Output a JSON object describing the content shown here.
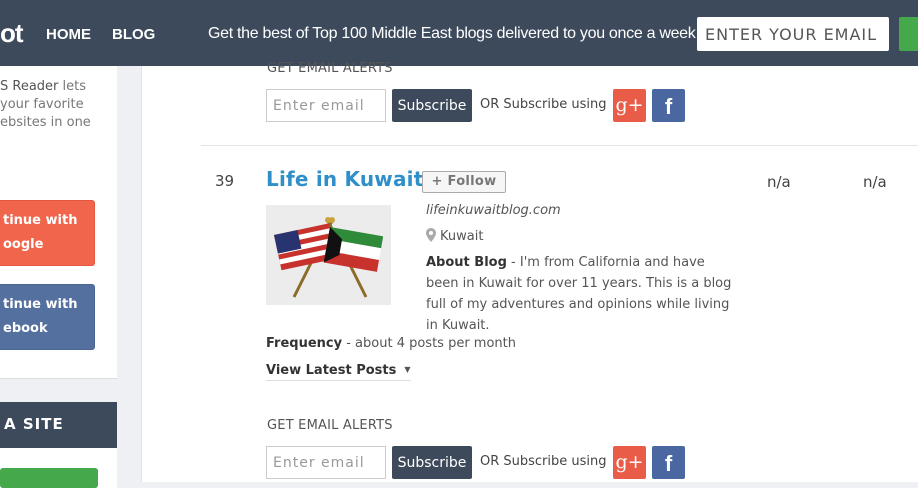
{
  "header": {
    "logo_text": "ot",
    "nav": [
      "HOME",
      "BLOG"
    ],
    "tagline": "Get the best of Top 100 Middle East blogs delivered to you once a week",
    "email_placeholder": "ENTER YOUR EMAIL ADDRESS",
    "colors": {
      "bar": "#3d4a5c",
      "go_button": "#45a84a"
    }
  },
  "sidebar": {
    "reader_brand": "S Reader",
    "reader_rest": " lets",
    "reader_line2": "your favorite",
    "reader_line3": "ebsites in one",
    "google_line1": "tinue with",
    "google_line2": "oogle",
    "facebook_line1": "tinue with",
    "facebook_line2": "ebook",
    "add_site": "A SITE"
  },
  "alerts_top": {
    "label": "GET EMAIL ALERTS",
    "email_placeholder": "Enter email",
    "subscribe": "Subscribe",
    "or_text": "OR  Subscribe using",
    "gplus_icon": "g+",
    "facebook_icon": "f"
  },
  "entry": {
    "rank": "39",
    "title": "Life in Kuwait",
    "follow": "+ Follow",
    "col1": "n/a",
    "col2": "n/a",
    "url": "lifeinkuwaitblog.com",
    "location": "Kuwait",
    "about_label": "About Blog",
    "about_text": " - I'm from California and have been in Kuwait for over 11 years. This is a blog full of my adventures and opinions while living in Kuwait.",
    "frequency_label": "Frequency",
    "frequency_text": " - about 4 posts per month",
    "latest_posts": "View Latest Posts"
  },
  "alerts_bottom": {
    "label": "GET EMAIL ALERTS",
    "email_placeholder": "Enter email",
    "subscribe": "Subscribe",
    "or_text": "OR  Subscribe using",
    "gplus_icon": "g+",
    "facebook_icon": "f"
  }
}
